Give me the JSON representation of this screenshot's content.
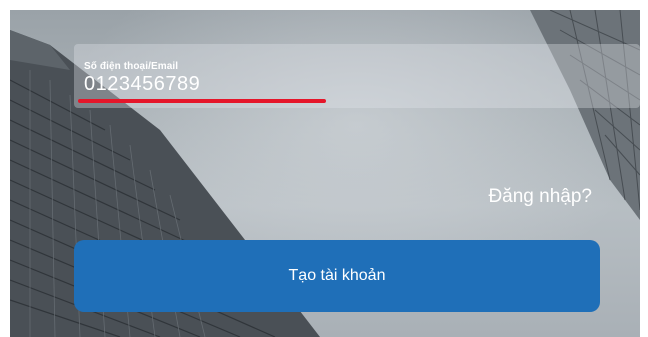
{
  "login_form": {
    "contact_field": {
      "label": "Số điện thoại/Email",
      "value": "0123456789"
    },
    "login_link": "Đăng nhập?",
    "create_account_button": "Tạo tài khoản"
  },
  "colors": {
    "button": "#1f6fb8",
    "underline_highlight": "#e5162a"
  }
}
